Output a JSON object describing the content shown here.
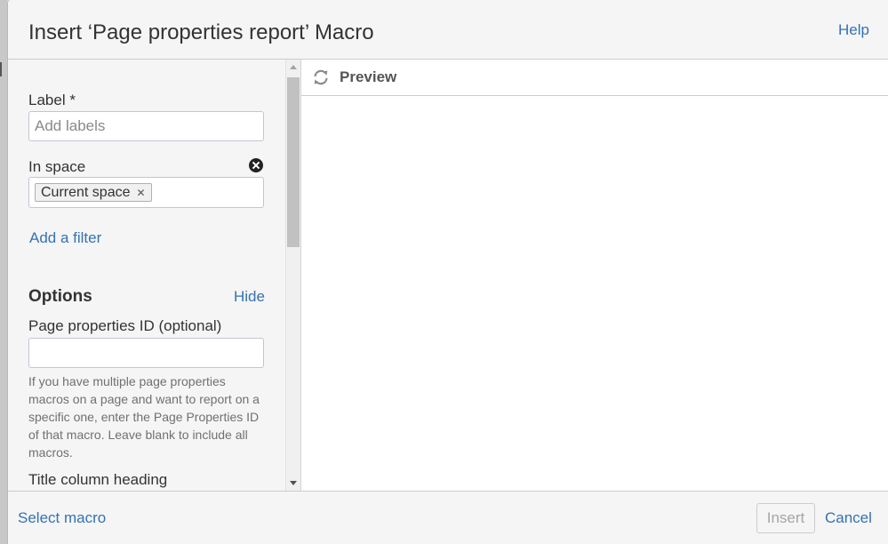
{
  "dialog": {
    "title": "Insert ‘Page properties report’ Macro",
    "help_label": "Help"
  },
  "form": {
    "label_field": {
      "label": "Label *",
      "placeholder": "Add labels",
      "value": ""
    },
    "space_field": {
      "label": "In space",
      "clear_icon": "circle-x-icon",
      "tokens": [
        {
          "label": "Current space",
          "remove_glyph": "✕"
        }
      ]
    },
    "add_filter_label": "Add a filter",
    "options": {
      "heading": "Options",
      "toggle_label": "Hide",
      "page_properties_id": {
        "label": "Page properties ID (optional)",
        "value": "",
        "help_text": "If you have multiple page properties macros on a page and want to report on a specific one, enter the Page Properties ID of that macro. Leave blank to include all macros."
      },
      "title_column_heading": {
        "label": "Title column heading"
      }
    }
  },
  "preview": {
    "label": "Preview",
    "icon": "refresh-icon"
  },
  "footer": {
    "select_macro_label": "Select macro",
    "insert_label": "Insert",
    "cancel_label": "Cancel"
  },
  "colors": {
    "link": "#3572b0",
    "panel_background": "#f5f5f5",
    "text": "#333333",
    "disabled_text": "#a5a5a5"
  }
}
